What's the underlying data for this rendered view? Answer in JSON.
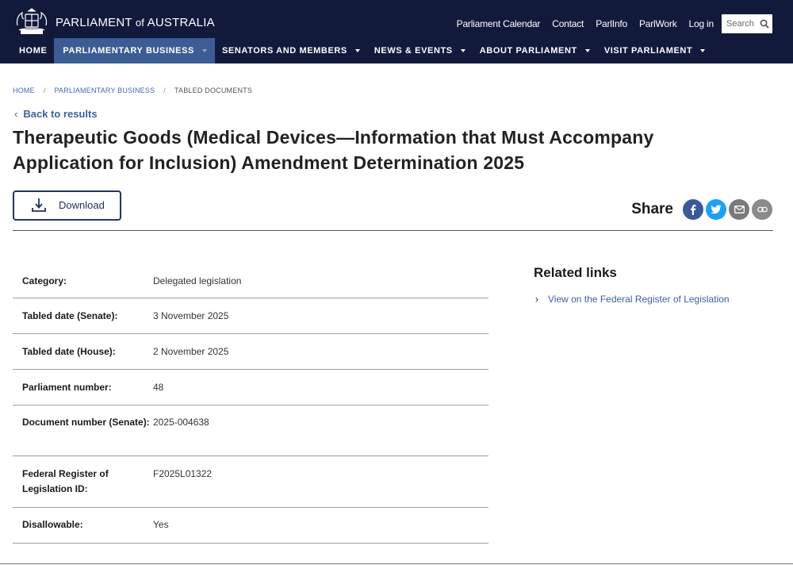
{
  "header": {
    "site_title_main": "PARLIAMENT",
    "site_title_of": "of",
    "site_title_end": "AUSTRALIA",
    "crest_text": "AUSTRALIA",
    "utility_links": [
      "Parliament Calendar",
      "Contact",
      "ParlInfo",
      "ParlWork",
      "Log in"
    ],
    "search_placeholder": "Search"
  },
  "nav": {
    "home": "HOME",
    "items": [
      {
        "label": "PARLIAMENTARY BUSINESS",
        "active": true
      },
      {
        "label": "SENATORS AND MEMBERS",
        "active": false
      },
      {
        "label": "NEWS & EVENTS",
        "active": false
      },
      {
        "label": "ABOUT PARLIAMENT",
        "active": false
      },
      {
        "label": "VISIT PARLIAMENT",
        "active": false
      }
    ]
  },
  "breadcrumb": [
    "HOME",
    "PARLIAMENTARY BUSINESS",
    "TABLED DOCUMENTS"
  ],
  "back_link": "Back to results",
  "title": "Therapeutic Goods (Medical Devices—Information that Must Accompany Application for Inclusion) Amendment Determination 2025",
  "download_label": "Download",
  "share": {
    "label": "Share",
    "buttons": [
      {
        "icon": "facebook-icon",
        "color": "#3b5998"
      },
      {
        "icon": "twitter-icon",
        "color": "#1da1f2"
      },
      {
        "icon": "email-icon",
        "color": "#7a7a7a"
      },
      {
        "icon": "link-icon",
        "color": "#8a8a8a"
      }
    ]
  },
  "details": [
    {
      "label": "Category:",
      "value": "Delegated legislation"
    },
    {
      "label": "Tabled date (Senate):",
      "value": "3 November 2025"
    },
    {
      "label": "Tabled date (House):",
      "value": "2 November 2025"
    },
    {
      "label": "Parliament number:",
      "value": "48"
    },
    {
      "label": "Document number (Senate):",
      "value": "2025-004638"
    },
    {
      "label": "Federal Register of Legislation ID:",
      "value": "F2025L01322"
    },
    {
      "label": "Disallowable:",
      "value": "Yes"
    }
  ],
  "related": {
    "title": "Related links",
    "links": [
      "View on the Federal Register of Legislation"
    ]
  },
  "colors": {
    "header_bg": "#121a3c",
    "nav_active_bg": "#3c5c94",
    "link": "#3f5f9e"
  }
}
